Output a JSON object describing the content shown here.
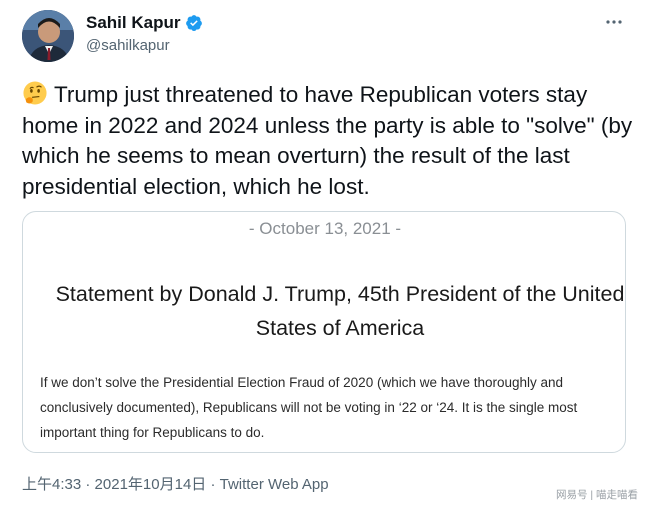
{
  "author": {
    "name": "Sahil Kapur",
    "handle": "@sahilkapur",
    "verified_icon": "verified-badge-icon",
    "accent_color": "#1d9bf0"
  },
  "more_icon": "more-options-icon",
  "tweet": {
    "emoji": "thinking-face-emoji",
    "text": "Trump just threatened to have Republican voters stay home in 2022 and 2024 unless the party is able to \"solve\" (by which he seems to mean overturn) the result of the last presidential election, which he lost."
  },
  "card": {
    "date": "- October 13, 2021 -",
    "heading": "Statement by Donald J. Trump, 45th President of the United States of America",
    "body": "If we don’t solve the Presidential Election Fraud of 2020 (which we have thoroughly and conclusively documented), Republicans will not be voting in ‘22 or ‘24. It is the single most important thing for Republicans to do."
  },
  "meta": {
    "time": "上午4:33",
    "separator": "·",
    "date": "2021年10月14日",
    "app": "Twitter Web App"
  },
  "watermark": "网易号 | 喵走喵看"
}
